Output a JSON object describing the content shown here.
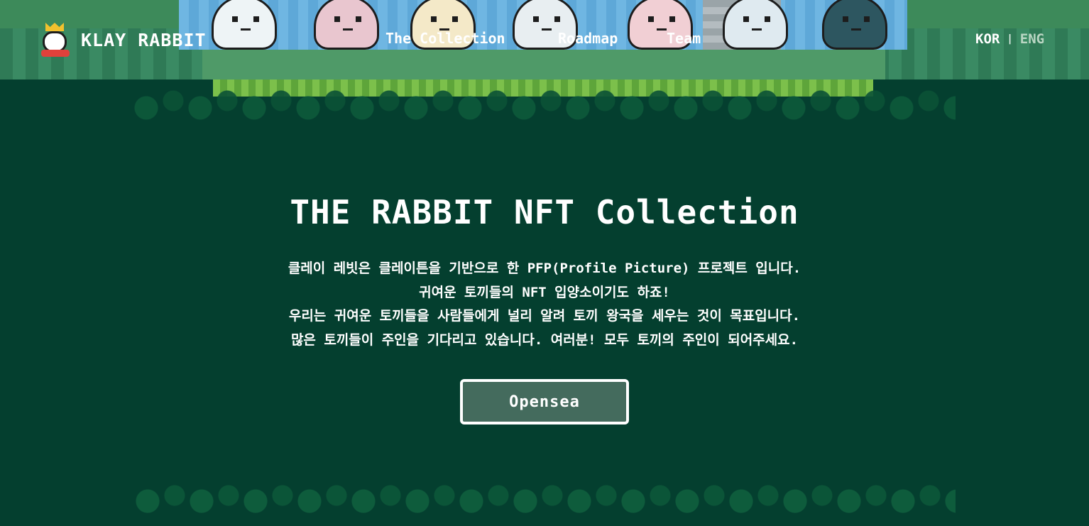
{
  "header": {
    "logo_text": "KLAY RABBIT",
    "nav": [
      {
        "label": "The Collection"
      },
      {
        "label": "Roadmap"
      },
      {
        "label": "Team"
      }
    ],
    "lang": {
      "kor": "KOR",
      "separator": "|",
      "eng": "ENG"
    }
  },
  "hero": {
    "title": "THE RABBIT NFT Collection",
    "lines": [
      "클레이 레빗은 클레이튼을 기반으로 한 PFP(Profile Picture) 프로젝트 입니다.",
      "귀여운 토끼들의 NFT 입양소이기도 하죠!",
      "우리는 귀여운 토끼들을 사람들에게 널리 알려 토끼 왕국을 세우는 것이 목표입니다.",
      "많은 토끼들이 주인을 기다리고 있습니다. 여러분! 모두 토끼의 주인이 되어주세요."
    ],
    "button_label": "Opensea"
  },
  "colors": {
    "background": "#043f2f",
    "button_fill": "#446b5d",
    "text": "#ffffff"
  }
}
